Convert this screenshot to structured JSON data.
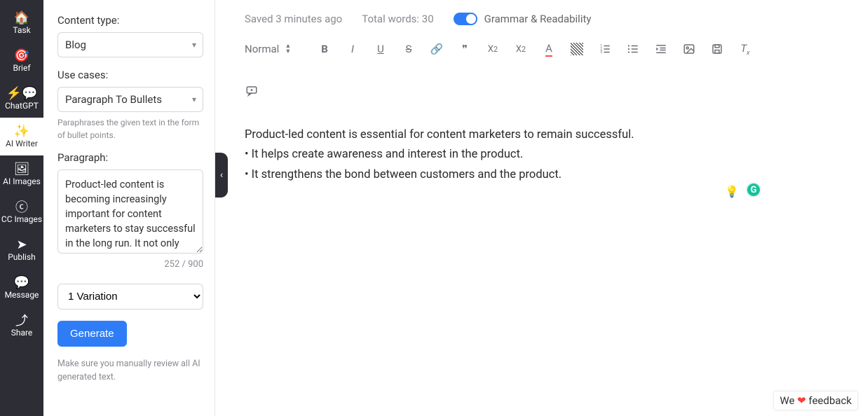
{
  "sidebar": {
    "items": [
      {
        "label": "Task",
        "icon": "🏠"
      },
      {
        "label": "Brief",
        "icon": "🎯"
      },
      {
        "label": "ChatGPT",
        "icon": "⚡💬"
      },
      {
        "label": "AI Writer",
        "icon": "✨"
      },
      {
        "label": "AI Images",
        "icon": "🖼"
      },
      {
        "label": "CC Images",
        "icon": "ⓒ"
      },
      {
        "label": "Publish",
        "icon": "➤"
      },
      {
        "label": "Message",
        "icon": "💬"
      },
      {
        "label": "Share",
        "icon": "⤴"
      }
    ]
  },
  "panel": {
    "content_type_label": "Content type:",
    "content_type_value": "Blog",
    "use_cases_label": "Use cases:",
    "use_cases_value": "Paragraph To Bullets",
    "use_cases_hint": "Paraphrases the given text in the form of bullet points.",
    "paragraph_label": "Paragraph:",
    "paragraph_value": "Product-led content is becoming increasingly important for content marketers to stay successful in the long run. It not only",
    "char_count": "252 / 900",
    "variation_value": "1 Variation",
    "generate_label": "Generate",
    "footnote": "Make sure you manually review all AI generated text."
  },
  "status": {
    "saved": "Saved 3 minutes ago",
    "words": "Total words: 30",
    "grammar_label": "Grammar & Readability"
  },
  "toolbar": {
    "format_value": "Normal"
  },
  "editor": {
    "line1": "Product-led content is essential for content marketers to remain successful.",
    "line2": "• It helps create awareness and interest in the product.",
    "line3": "• It strengthens the bond between customers and the product."
  },
  "feedback": {
    "pre": "We ",
    "post": " feedback"
  }
}
